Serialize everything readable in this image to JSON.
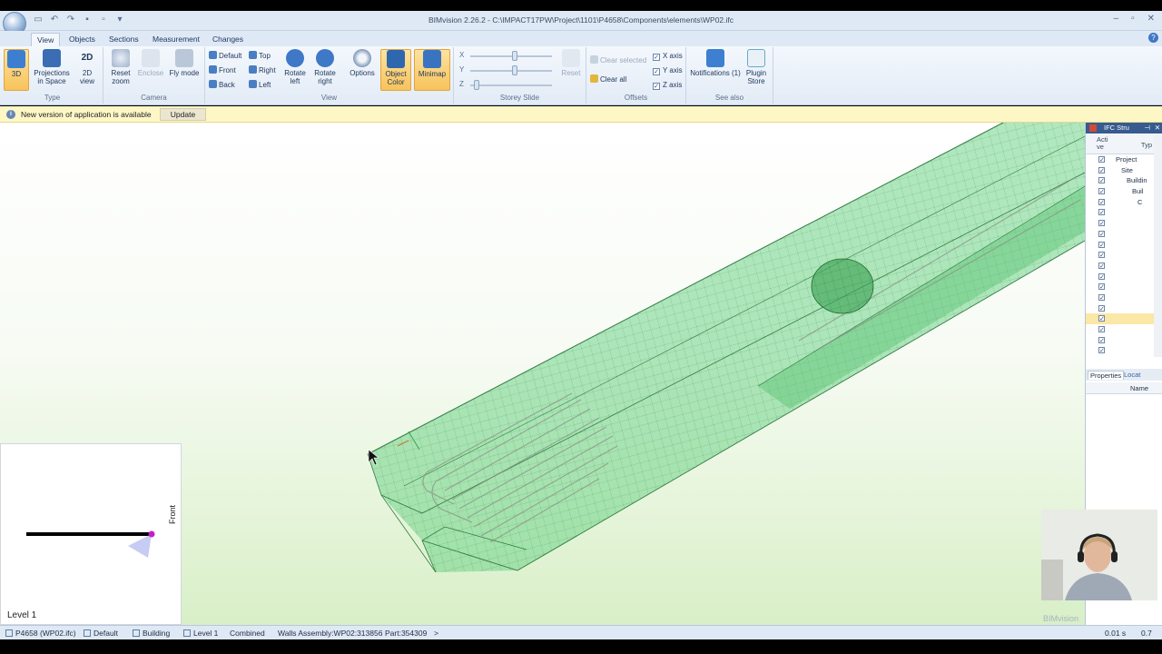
{
  "window": {
    "title": "BIMvision 2.26.2 - C:\\IMPACT17PW\\Project\\1101\\P4658\\Components\\elements\\WP02.ifc",
    "minimize": "–",
    "maximize": "▫",
    "close": "✕"
  },
  "tabs": [
    "View",
    "Objects",
    "Sections",
    "Measurement",
    "Changes"
  ],
  "ribbon": {
    "type": {
      "label": "Type",
      "btn_3d": "3D",
      "projections": "Projections in Space",
      "view2d": "2D view",
      "view2d_icon": "2D"
    },
    "camera": {
      "label": "Camera",
      "reset_zoom": "Reset zoom",
      "enclose": "Enclose",
      "fly_mode": "Fly mode"
    },
    "view": {
      "label": "View",
      "default": "Default",
      "top": "Top",
      "front": "Front",
      "right": "Right",
      "back": "Back",
      "left": "Left",
      "rotate_left": "Rotate left",
      "rotate_right": "Rotate right",
      "options": "Options",
      "object_color": "Object Color",
      "minimap": "Minimap"
    },
    "storey": {
      "label": "Storey Slide",
      "x": "X",
      "y": "Y",
      "z": "Z",
      "reset": "Reset"
    },
    "offsets": {
      "label": "Offsets",
      "clear_selected": "Clear selected",
      "clear_all": "Clear all",
      "x_axis": "X axis",
      "y_axis": "Y axis",
      "z_axis": "Z axis"
    },
    "see_also": {
      "label": "See also",
      "notifications": "Notifications (1)",
      "plugin_store": "Plugin Store"
    }
  },
  "notification": {
    "message": "New version of application is available",
    "button": "Update"
  },
  "viewport": {
    "level": "Level 1",
    "front_label": "Front",
    "watermark": "BIMvision"
  },
  "panel": {
    "title": "IFC Stru",
    "col_active": "Acti ve",
    "col_type": "Typ",
    "tree": [
      "Project",
      "Site",
      "Buildin",
      "Buil",
      "C",
      "",
      "",
      "",
      "",
      "",
      "",
      "",
      "",
      "",
      "",
      "",
      "",
      "",
      ""
    ],
    "tabs": [
      "Properties",
      "Locat"
    ],
    "props_name": "Name"
  },
  "status": {
    "file": "P4658 (WP02.ifc)",
    "mode": "Default",
    "building": "Building",
    "level": "Level 1",
    "combined": "Combined",
    "assembly": "Walls Assembly:WP02:313856",
    "part": "Part:354309",
    "time": "0.01 s",
    "zoom": "0.7"
  },
  "colors": {
    "accent": "#f7c35b",
    "model_fill": "#5fcf7a",
    "model_edge": "#2f7a3f",
    "ribbon": "#e2ebf6"
  }
}
